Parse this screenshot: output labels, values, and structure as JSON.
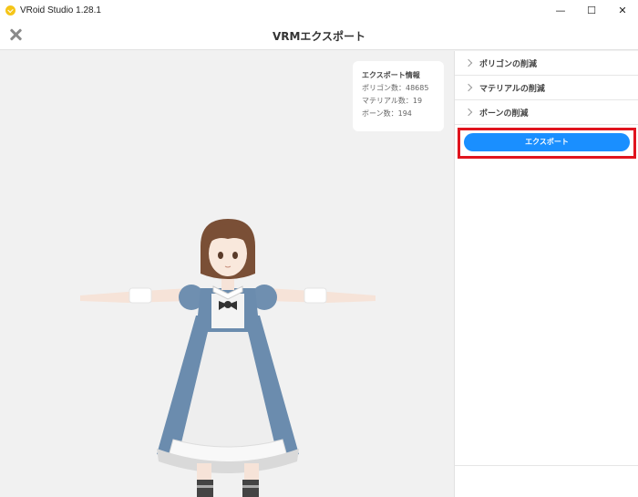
{
  "window": {
    "app_title": "VRoid Studio 1.28.1",
    "minimize_glyph": "—",
    "maximize_glyph": "☐",
    "close_glyph": "✕"
  },
  "header": {
    "title": "VRMエクスポート",
    "close_icon": "close-icon"
  },
  "export_info": {
    "title": "エクスポート情報",
    "polygon_count": "ポリゴン数：48685",
    "material_count": "マテリアル数：19",
    "bone_count": "ボーン数：194"
  },
  "panel": {
    "sections": [
      {
        "label": "ポリゴンの削減"
      },
      {
        "label": "マテリアルの削減"
      },
      {
        "label": "ボーンの削減"
      }
    ],
    "export_button": "エクスポート"
  },
  "colors": {
    "accent": "#1a8fff",
    "highlight": "#e0141e",
    "logo": "#f5c518"
  }
}
